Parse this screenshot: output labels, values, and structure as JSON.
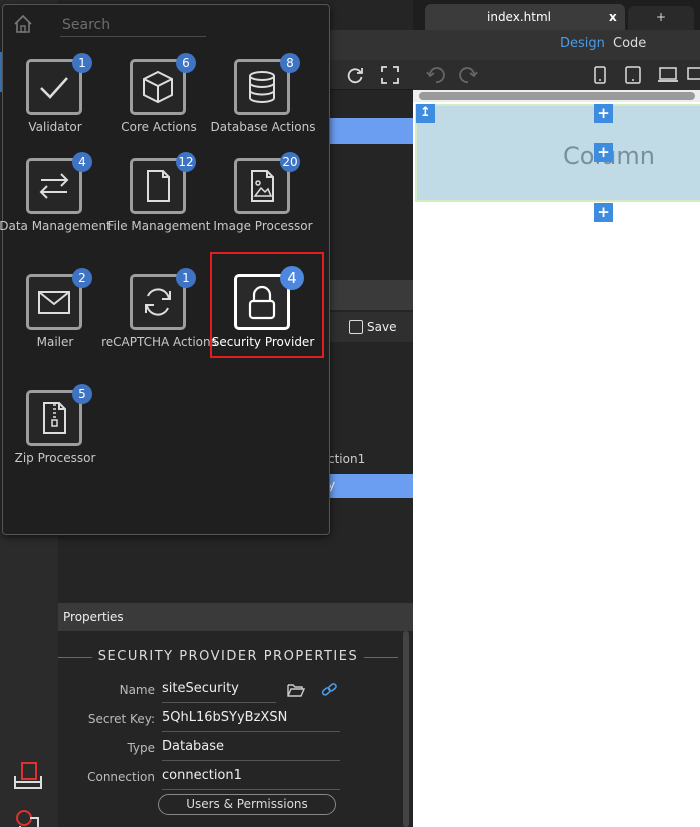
{
  "popup": {
    "search_placeholder": "Search",
    "items": [
      {
        "label": "Validator",
        "count": "1"
      },
      {
        "label": "Core Actions",
        "count": "6"
      },
      {
        "label": "Database Actions",
        "count": "8"
      },
      {
        "label": "Data Management",
        "count": "4"
      },
      {
        "label": "File Management",
        "count": "12"
      },
      {
        "label": "Image Processor",
        "count": "20"
      },
      {
        "label": "Mailer",
        "count": "2"
      },
      {
        "label": "reCAPTCHA Actions",
        "count": "1"
      },
      {
        "label": "Security Provider",
        "count": "4"
      },
      {
        "label": "Zip Processor",
        "count": "5"
      }
    ]
  },
  "middle": {
    "save_label": "Save",
    "tree_item_1": "ction1",
    "tree_item_2": "y"
  },
  "properties": {
    "header": "Properties",
    "title": "SECURITY PROVIDER PROPERTIES",
    "rows": {
      "name": {
        "label": "Name",
        "value": "siteSecurity"
      },
      "secret": {
        "label": "Secret Key:",
        "value": "5QhL16bSYyBzXSN"
      },
      "type": {
        "label": "Type",
        "value": "Database"
      },
      "connection": {
        "label": "Connection",
        "value": "connection1"
      }
    },
    "users_button": "Users & Permissions"
  },
  "editor": {
    "tab_name": "index.html",
    "tab_close": "x",
    "new_tab": "+",
    "view_design": "Design",
    "view_code": "Code",
    "column_text": "Column",
    "add_symbol": "+",
    "move_symbol": "↥"
  },
  "colors": {
    "accent": "#3d8ce0",
    "badge": "#3f74c4",
    "selection_frame": "#e02020",
    "column_bg": "#c0dbe6"
  }
}
